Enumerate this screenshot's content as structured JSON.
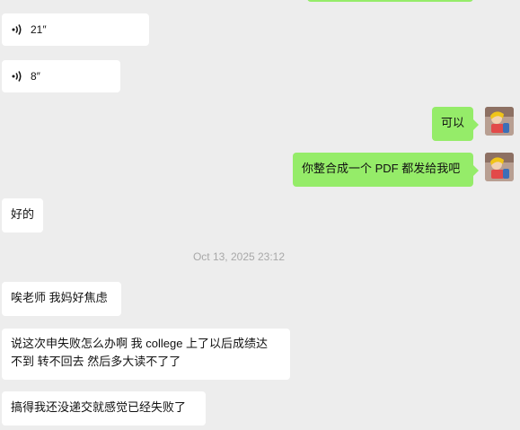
{
  "voice_messages": [
    {
      "duration": "21″",
      "icon": "voice-wave-icon"
    },
    {
      "duration": "8″",
      "icon": "voice-wave-icon"
    }
  ],
  "outgoing": {
    "msg1": "可以",
    "msg2": "你整合成一个 PDF 都发给我吧"
  },
  "incoming": {
    "good": "好的",
    "worried": "唉老师 我妈好焦虑",
    "college_line1": "说这次申失败怎么办啊 我 college 上了以后成绩达",
    "college_line2": "不到 转不回去 然后多大读不了了",
    "fail": "搞得我还没递交就感觉已经失败了"
  },
  "timestamp": "Oct 13, 2025 23:12",
  "colors": {
    "outgoing_bubble": "#95ec69",
    "incoming_bubble": "#ffffff",
    "background": "#ededed",
    "timestamp_text": "#a8a8a8"
  }
}
